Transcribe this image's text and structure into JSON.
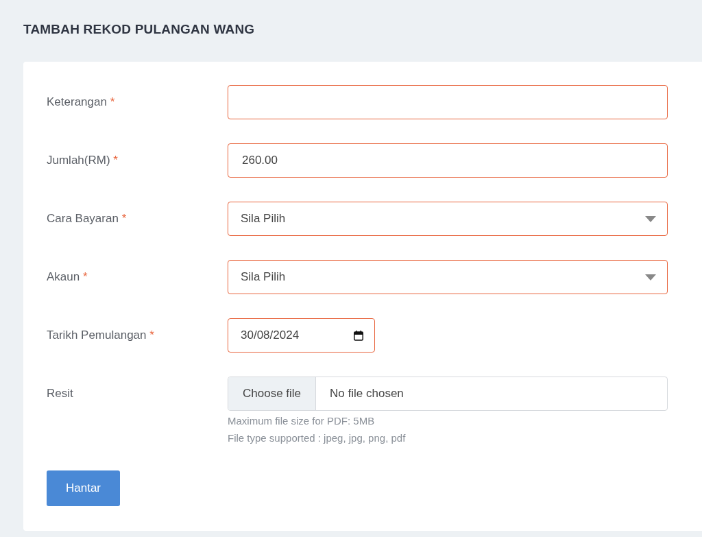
{
  "title": "TAMBAH REKOD PULANGAN WANG",
  "required_mark": "*",
  "fields": [
    {
      "label": "Keterangan",
      "required": true,
      "kind": "text",
      "invalid": true
    },
    {
      "label": "Jumlah(RM)",
      "required": true,
      "kind": "text",
      "value": "260.00",
      "invalid": true
    },
    {
      "label": "Cara Bayaran",
      "required": true,
      "kind": "select",
      "value": "Sila Pilih",
      "invalid": true
    },
    {
      "label": "Akaun",
      "required": true,
      "kind": "select",
      "value": "Sila Pilih",
      "invalid": true
    },
    {
      "label": "Tarikh Pemulangan",
      "required": true,
      "kind": "date",
      "value": "30/08/2024",
      "invalid": true
    },
    {
      "label": "Resit",
      "required": false,
      "kind": "file",
      "button": "Choose file",
      "value": "No file chosen",
      "invalid": false,
      "hints": [
        "Maximum file size for PDF: 5MB",
        "File type supported : jpeg, jpg, png, pdf"
      ]
    }
  ],
  "submit": "Hantar"
}
